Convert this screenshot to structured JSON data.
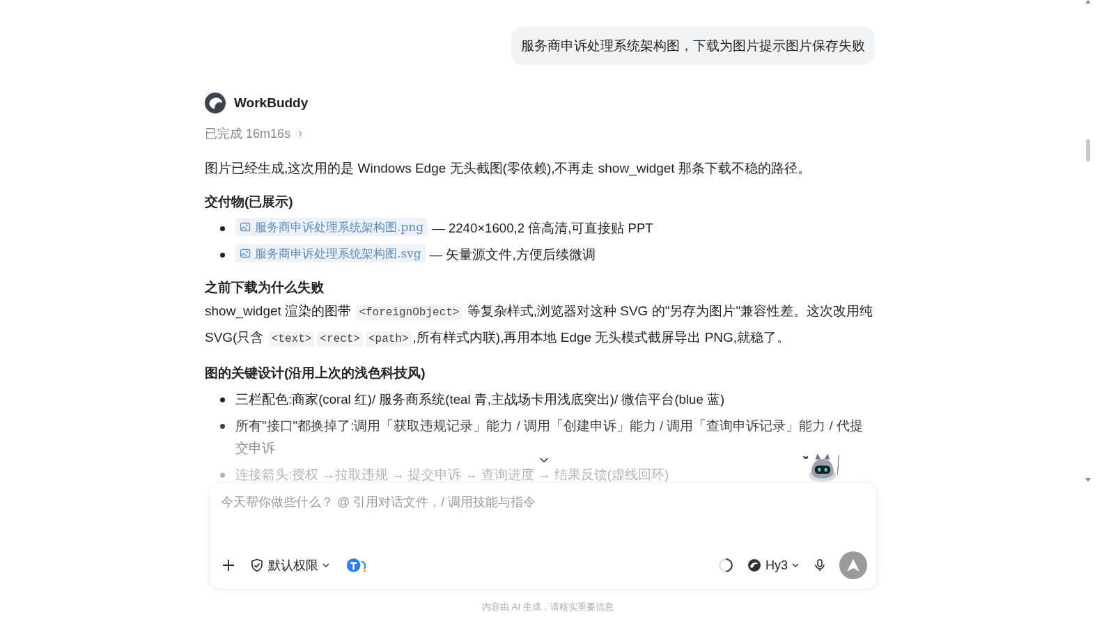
{
  "user_message": {
    "text": "服务商申诉处理系统架构图，下载为图片提示图片保存失败"
  },
  "assistant": {
    "name": "WorkBuddy",
    "status": "已完成 16m16s"
  },
  "blocks": [
    {
      "kind": "paragraph",
      "parts": [
        {
          "kind": "text",
          "text": "图片已经生成,这次用的是 Windows Edge 无头截图(零依赖),不再走 show_widget 那条下载不稳的路径。"
        }
      ]
    },
    {
      "kind": "heading",
      "text": "交付物(已展示)"
    },
    {
      "kind": "list",
      "items": [
        {
          "kind": "file",
          "file": "服务商申诉处理系统架构图.png",
          "text": "— 2240×1600,2 倍高清,可直接贴 PPT"
        },
        {
          "kind": "file",
          "file": "服务商申诉处理系统架构图.svg",
          "text": "— 矢量源文件,方便后续微调"
        }
      ]
    },
    {
      "kind": "heading",
      "text": "之前下载为什么失败"
    },
    {
      "kind": "paragraph",
      "parts": [
        {
          "kind": "text",
          "text": "show_widget 渲染的图带 "
        },
        {
          "kind": "code",
          "text": "<foreignObject>"
        },
        {
          "kind": "text",
          "text": " 等复杂样式,浏览器对这种 SVG 的\"另存为图片\"兼容性差。这次改用纯 SVG(只含 "
        },
        {
          "kind": "code",
          "text": "<text>"
        },
        {
          "kind": "code",
          "text": "<rect>"
        },
        {
          "kind": "code",
          "text": "<path>"
        },
        {
          "kind": "text",
          "text": ",所有样式内联),再用本地 Edge 无头模式截屏导出 PNG,就稳了。"
        }
      ]
    },
    {
      "kind": "heading",
      "text": "图的关键设计(沿用上次的浅色科技风)"
    },
    {
      "kind": "list",
      "items": [
        {
          "kind": "text",
          "text": "三栏配色:商家(coral 红)/ 服务商系统(teal 青,主战场卡用浅底突出)/ 微信平台(blue 蓝)"
        },
        {
          "kind": "text",
          "text": "所有\"接口\"都换掉了:调用「获取违规记录」能力 / 调用「创建申诉」能力 / 调用「查询申诉记录」能力 / 代提交申诉"
        },
        {
          "kind": "text",
          "text": "连接箭头:授权 →拉取违规 → 提交申诉 → 查询进度 → 结果反馈(虚线回环)"
        }
      ]
    }
  ],
  "composer": {
    "placeholder": "今天帮你做些什么？ @ 引用对话文件，/ 调用技能与指令",
    "permission": "默认权限",
    "model": "Hy3"
  },
  "footer_note": "内容由 AI 生成，请核实重要信息"
}
